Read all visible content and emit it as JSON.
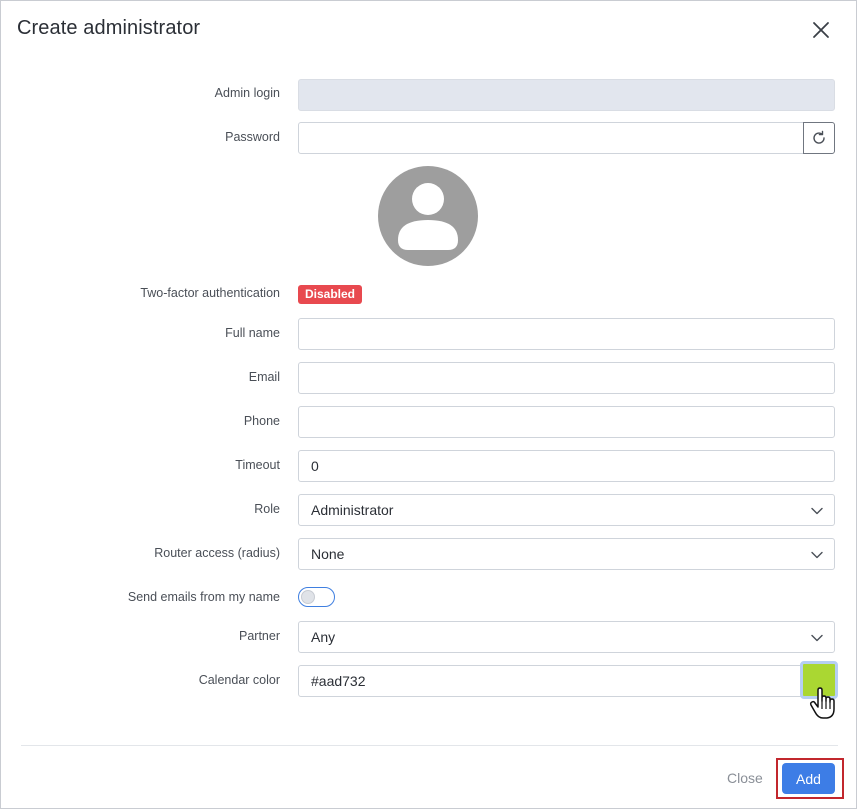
{
  "dialog": {
    "title": "Create administrator"
  },
  "form": {
    "admin_login": {
      "label": "Admin login",
      "value": ""
    },
    "password": {
      "label": "Password",
      "value": ""
    },
    "two_factor": {
      "label": "Two-factor authentication",
      "status": "Disabled"
    },
    "full_name": {
      "label": "Full name",
      "value": ""
    },
    "email": {
      "label": "Email",
      "value": ""
    },
    "phone": {
      "label": "Phone",
      "value": ""
    },
    "timeout": {
      "label": "Timeout",
      "value": "0"
    },
    "role": {
      "label": "Role",
      "selected": "Administrator"
    },
    "router_access": {
      "label": "Router access (radius)",
      "selected": "None"
    },
    "send_emails": {
      "label": "Send emails from my name",
      "enabled": false
    },
    "partner": {
      "label": "Partner",
      "selected": "Any"
    },
    "calendar_color": {
      "label": "Calendar color",
      "value": "#aad732"
    }
  },
  "footer": {
    "close_label": "Close",
    "add_label": "Add"
  },
  "colors": {
    "primary": "#3d7de6",
    "badge_disabled": "#e8494f",
    "highlight": "#c2272d",
    "swatch": "#aad732"
  },
  "icons": {
    "close": "close-icon",
    "refresh": "refresh-icon",
    "avatar": "user-avatar-icon",
    "chevron": "chevron-down-icon",
    "cursor": "hand-pointer-icon"
  }
}
